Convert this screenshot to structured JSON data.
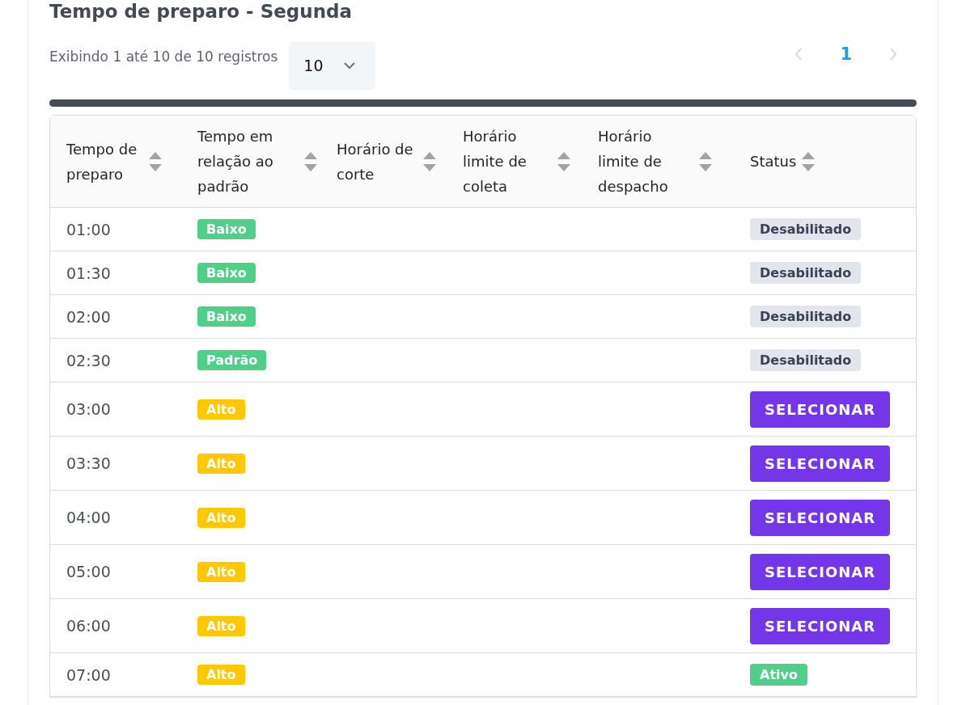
{
  "card": {
    "title": "Tempo de preparo - Segunda"
  },
  "pagination": {
    "summary": "Exibindo 1 até 10 de 10 registros",
    "page_size": "10",
    "pages": [
      {
        "label": "1",
        "selected": true
      }
    ],
    "prev_disabled": true,
    "next_disabled": true
  },
  "table": {
    "columns": [
      "Tempo de preparo",
      "Tempo em relação ao padrão",
      "Horário de corte",
      "Horário limite de coleta",
      "Horário limite de despacho",
      "Status"
    ],
    "rows": [
      {
        "time": "01:00",
        "level_tag": {
          "label": "Baixo",
          "color": "#4fcf87"
        },
        "status": {
          "kind": "badge",
          "label": "Desabilitado",
          "color": "#e3e5ed"
        }
      },
      {
        "time": "01:30",
        "level_tag": {
          "label": "Baixo",
          "color": "#4fcf87"
        },
        "status": {
          "kind": "badge",
          "label": "Desabilitado",
          "color": "#e3e5ed"
        }
      },
      {
        "time": "02:00",
        "level_tag": {
          "label": "Baixo",
          "color": "#4fcf87"
        },
        "status": {
          "kind": "badge",
          "label": "Desabilitado",
          "color": "#e3e5ed"
        }
      },
      {
        "time": "02:30",
        "level_tag": {
          "label": "Padrão",
          "color": "#4fcf87"
        },
        "status": {
          "kind": "badge",
          "label": "Desabilitado",
          "color": "#e3e5ed"
        }
      },
      {
        "time": "03:00",
        "level_tag": {
          "label": "Alto",
          "color": "#ffc800"
        },
        "status": {
          "kind": "button",
          "label": "SELECIONAR"
        }
      },
      {
        "time": "03:30",
        "level_tag": {
          "label": "Alto",
          "color": "#ffc800"
        },
        "status": {
          "kind": "button",
          "label": "SELECIONAR"
        }
      },
      {
        "time": "04:00",
        "level_tag": {
          "label": "Alto",
          "color": "#ffc800"
        },
        "status": {
          "kind": "button",
          "label": "SELECIONAR"
        }
      },
      {
        "time": "05:00",
        "level_tag": {
          "label": "Alto",
          "color": "#ffc800"
        },
        "status": {
          "kind": "button",
          "label": "SELECIONAR"
        }
      },
      {
        "time": "06:00",
        "level_tag": {
          "label": "Alto",
          "color": "#ffc800"
        },
        "status": {
          "kind": "button",
          "label": "SELECIONAR"
        }
      },
      {
        "time": "07:00",
        "level_tag": {
          "label": "Alto",
          "color": "#ffc800"
        },
        "status": {
          "kind": "badge",
          "label": "Ativo",
          "color": "#4fcf87"
        }
      }
    ]
  }
}
